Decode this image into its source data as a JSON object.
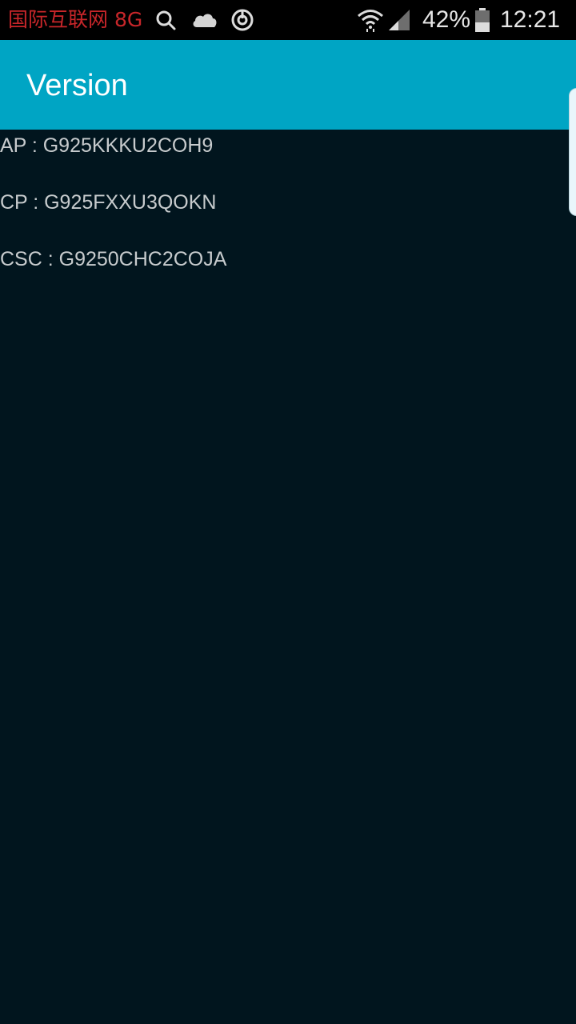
{
  "status_bar": {
    "carrier": "国际互联网 8G",
    "battery_percent": "42%",
    "time": "12:21",
    "icons": [
      "search-icon",
      "cloud-icon",
      "sync-icon",
      "wifi-icon",
      "signal-icon",
      "battery-icon"
    ]
  },
  "app_bar": {
    "title": "Version"
  },
  "versions": [
    {
      "text": "AP : G925KKKU2COH9"
    },
    {
      "text": "CP : G925FXXU3QOKN"
    },
    {
      "text": "CSC : G9250CHC2COJA"
    }
  ],
  "colors": {
    "status_bar_bg": "#000000",
    "carrier_text": "#c8262a",
    "app_bar_bg": "#00a5c4",
    "content_bg": "#01151e",
    "content_text": "#c7cbcd"
  }
}
